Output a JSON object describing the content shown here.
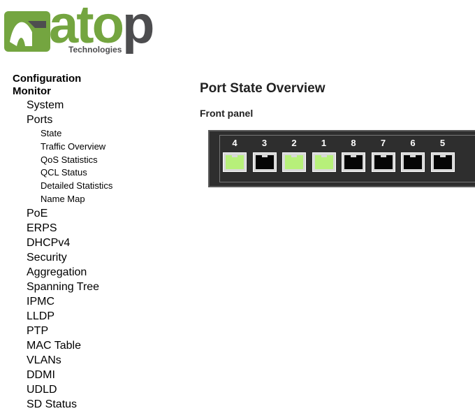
{
  "logo": {
    "brand": "atop",
    "sub": "Technologies"
  },
  "menu": {
    "configuration": "Configuration",
    "monitor": "Monitor",
    "items": [
      {
        "label": "System",
        "level": 1
      },
      {
        "label": "Ports",
        "level": 1
      },
      {
        "label": "State",
        "level": 2
      },
      {
        "label": "Traffic Overview",
        "level": 2
      },
      {
        "label": "QoS Statistics",
        "level": 2
      },
      {
        "label": "QCL Status",
        "level": 2
      },
      {
        "label": "Detailed Statistics",
        "level": 2
      },
      {
        "label": "Name Map",
        "level": 2
      },
      {
        "label": "PoE",
        "level": 1
      },
      {
        "label": "ERPS",
        "level": 1
      },
      {
        "label": "DHCPv4",
        "level": 1
      },
      {
        "label": "Security",
        "level": 1
      },
      {
        "label": "Aggregation",
        "level": 1
      },
      {
        "label": "Spanning Tree",
        "level": 1
      },
      {
        "label": "IPMC",
        "level": 1
      },
      {
        "label": "LLDP",
        "level": 1
      },
      {
        "label": "PTP",
        "level": 1
      },
      {
        "label": "MAC Table",
        "level": 1
      },
      {
        "label": "VLANs",
        "level": 1
      },
      {
        "label": "DDMI",
        "level": 1
      },
      {
        "label": "UDLD",
        "level": 1
      },
      {
        "label": "SD Status",
        "level": 1
      }
    ]
  },
  "main": {
    "title": "Port State Overview",
    "subtitle": "Front panel"
  },
  "ports": [
    {
      "number": "4",
      "link": "up"
    },
    {
      "number": "3",
      "link": "down"
    },
    {
      "number": "2",
      "link": "up"
    },
    {
      "number": "1",
      "link": "up"
    },
    {
      "number": "8",
      "link": "down"
    },
    {
      "number": "7",
      "link": "down"
    },
    {
      "number": "6",
      "link": "down"
    },
    {
      "number": "5",
      "link": "down"
    }
  ],
  "colors": {
    "brand_green": "#74a540",
    "brand_gray": "#4d4d4f",
    "link_up": "#b7f07a",
    "link_down": "#050505"
  }
}
